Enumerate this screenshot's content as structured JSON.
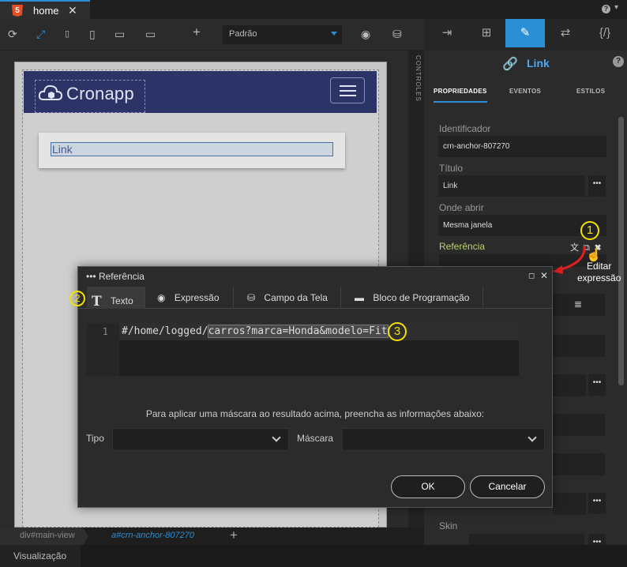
{
  "tabs": {
    "file_tab": "home",
    "file_icon": "5"
  },
  "toolbar": {
    "preset_value": "Padrão"
  },
  "canvas": {
    "logo_text": "Cronapp",
    "link_text": "Link",
    "controls_label": "CONTROLES"
  },
  "right_panel": {
    "title": "Link",
    "tabs": [
      "PROPRIEDADES",
      "EVENTOS",
      "ESTILOS"
    ],
    "fields": {
      "identificador_label": "Identificador",
      "identificador_value": "crn-anchor-807270",
      "titulo_label": "Título",
      "titulo_value": "Link",
      "onde_abrir_label": "Onde abrir",
      "onde_abrir_value": "Mesma janela",
      "referencia_label": "Referência",
      "skin_label": "Skin"
    },
    "dots": "•••",
    "tooltip_line1": "Editar",
    "tooltip_line2": "expressão"
  },
  "annotations": {
    "badge1": "1",
    "badge2": "2",
    "badge3": "3"
  },
  "dialog": {
    "title": "••• Referência",
    "tabs": [
      "Texto",
      "Expressão",
      "Campo da Tela",
      "Bloco de Programação"
    ],
    "editor": {
      "line_number": "1",
      "code_prefix": "#/home/logged/",
      "code_selected": "carros?marca=Honda&modelo=Fit"
    },
    "mask_hint": "Para aplicar uma máscara ao resultado acima, preencha as informações abaixo:",
    "tipo_label": "Tipo",
    "mascara_label": "Máscara",
    "ok_label": "OK",
    "cancel_label": "Cancelar"
  },
  "breadcrumb": {
    "item1": "div#main-view",
    "item2": "a#crn-anchor-807270"
  },
  "status": {
    "visualizacao": "Visualização"
  },
  "colors": {
    "accent": "#2a8fd4",
    "annotation": "#f5e100",
    "referencia": "#b9d36a",
    "navbar": "#2c3366"
  }
}
